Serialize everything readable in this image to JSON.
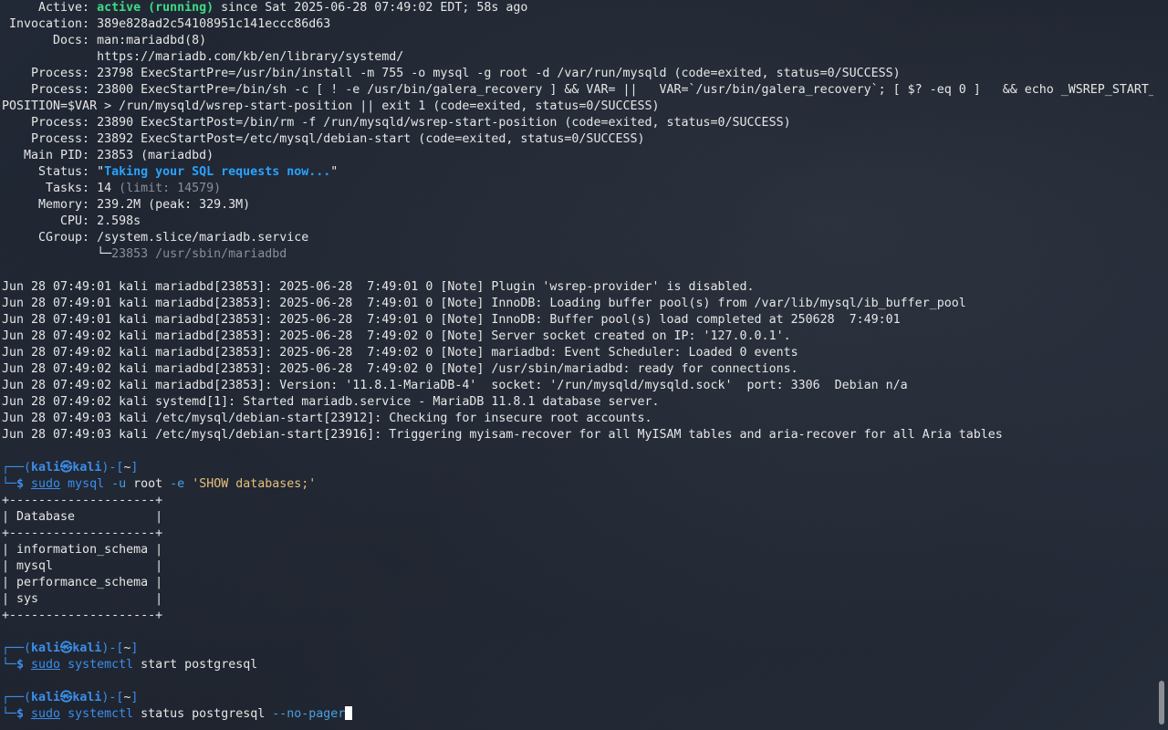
{
  "status_block": {
    "active_label": "     Active: ",
    "active_state": "active (running)",
    "active_since": " since Sat 2025-06-28 07:49:02 EDT; 58s ago",
    "invocation": " Invocation: 389e828ad2c54108951c141eccc86d63",
    "docs_1": "       Docs: man:mariadbd(8)",
    "docs_2": "             https://mariadb.com/kb/en/library/systemd/",
    "process_1": "    Process: 23798 ExecStartPre=/usr/bin/install -m 755 -o mysql -g root -d /var/run/mysqld (code=exited, status=0/SUCCESS)",
    "process_2a": "    Process: 23800 ExecStartPre=/bin/sh -c [ ! -e /usr/bin/galera_recovery ] && VAR= ||   VAR=`/usr/bin/galera_recovery`; [ $? -eq 0 ]   && echo _WSREP_START_",
    "process_2b": "POSITION=$VAR > /run/mysqld/wsrep-start-position || exit 1 (code=exited, status=0/SUCCESS)",
    "process_3": "    Process: 23890 ExecStartPost=/bin/rm -f /run/mysqld/wsrep-start-position (code=exited, status=0/SUCCESS)",
    "process_4": "    Process: 23892 ExecStartPost=/etc/mysql/debian-start (code=exited, status=0/SUCCESS)",
    "main_pid": "   Main PID: 23853 (mariadbd)",
    "status_label": "     Status: \"",
    "status_value": "Taking your SQL requests now...",
    "status_end": "\"",
    "tasks_label": "      Tasks: 14 ",
    "tasks_limit": "(limit: 14579)",
    "memory": "     Memory: 239.2M (peak: 329.3M)",
    "cpu": "        CPU: 2.598s",
    "cgroup": "     CGroup: /system.slice/mariadb.service",
    "cgroup_tree": "             └─",
    "cgroup_proc": "23853 /usr/sbin/mariadbd"
  },
  "journal": [
    "Jun 28 07:49:01 kali mariadbd[23853]: 2025-06-28  7:49:01 0 [Note] Plugin 'wsrep-provider' is disabled.",
    "Jun 28 07:49:01 kali mariadbd[23853]: 2025-06-28  7:49:01 0 [Note] InnoDB: Loading buffer pool(s) from /var/lib/mysql/ib_buffer_pool",
    "Jun 28 07:49:01 kali mariadbd[23853]: 2025-06-28  7:49:01 0 [Note] InnoDB: Buffer pool(s) load completed at 250628  7:49:01",
    "Jun 28 07:49:02 kali mariadbd[23853]: 2025-06-28  7:49:02 0 [Note] Server socket created on IP: '127.0.0.1'.",
    "Jun 28 07:49:02 kali mariadbd[23853]: 2025-06-28  7:49:02 0 [Note] mariadbd: Event Scheduler: Loaded 0 events",
    "Jun 28 07:49:02 kali mariadbd[23853]: 2025-06-28  7:49:02 0 [Note] /usr/sbin/mariadbd: ready for connections.",
    "Jun 28 07:49:02 kali mariadbd[23853]: Version: '11.8.1-MariaDB-4'  socket: '/run/mysqld/mysqld.sock'  port: 3306  Debian n/a",
    "Jun 28 07:49:02 kali systemd[1]: Started mariadb.service - MariaDB 11.8.1 database server.",
    "Jun 28 07:49:03 kali /etc/mysql/debian-start[23912]: Checking for insecure root accounts.",
    "Jun 28 07:49:03 kali /etc/mysql/debian-start[23916]: Triggering myisam-recover for all MyISAM tables and aria-recover for all Aria tables"
  ],
  "prompt": {
    "top_left": "┌──(",
    "user_host": "kali㉿kali",
    "top_right": ")-[",
    "cwd": "~",
    "top_end": "]",
    "bottom": "└─",
    "dollar": "$ "
  },
  "commands": {
    "cmd1": {
      "sudo": "sudo",
      "prog": " mysql",
      "opt_u": " -u",
      "user": " root",
      "opt_e": " -e",
      "query": " 'SHOW databases;'"
    },
    "cmd2": {
      "sudo": "sudo",
      "prog": " systemctl",
      "args": " start postgresql"
    },
    "cmd3": {
      "sudo": "sudo",
      "prog": " systemctl",
      "args": " status postgresql",
      "opt": " --no-pager"
    }
  },
  "db_table": {
    "border": "+--------------------+",
    "header": "| Database           |",
    "rows": [
      "| information_schema |",
      "| mysql              |",
      "| performance_schema |",
      "| sys                |"
    ]
  },
  "colors": {
    "background": "#1e2430",
    "active_green": "#3ddc84",
    "prompt_blue": "#3b8eea",
    "status_blue": "#29a3ff"
  }
}
